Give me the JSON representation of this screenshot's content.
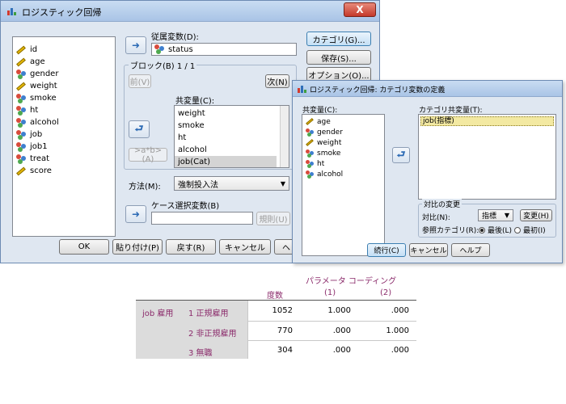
{
  "main_dialog": {
    "title": "ロジスティック回帰",
    "close_label": "X",
    "variables": [
      {
        "name": "id",
        "icon": "ruler-icon"
      },
      {
        "name": "age",
        "icon": "ruler-icon"
      },
      {
        "name": "gender",
        "icon": "nominal-icon"
      },
      {
        "name": "weight",
        "icon": "ruler-icon"
      },
      {
        "name": "smoke",
        "icon": "nominal-icon"
      },
      {
        "name": "ht",
        "icon": "nominal-icon"
      },
      {
        "name": "alcohol",
        "icon": "nominal-icon"
      },
      {
        "name": "job",
        "icon": "nominal-icon"
      },
      {
        "name": "job1",
        "icon": "nominal-icon"
      },
      {
        "name": "treat",
        "icon": "nominal-icon"
      },
      {
        "name": "score",
        "icon": "ruler-icon"
      }
    ],
    "dependent_label": "従属変数(D):",
    "dependent_value": "status",
    "block_label": "ブロック(B) 1 / 1",
    "prev_label": "前(V)",
    "next_label": "次(N)",
    "covariates_label": "共変量(C):",
    "covariates": [
      "weight",
      "smoke",
      "ht",
      "alcohol",
      "job(Cat)"
    ],
    "interaction_label": ">a*b>(A)",
    "method_label": "方法(M):",
    "method_value": "強制投入法",
    "selection_label": "ケース選択変数(B)",
    "rule_label": "規則(U)",
    "right_buttons": [
      "カテゴリ(G)...",
      "保存(S)...",
      "オプション(O)..."
    ],
    "bottom_buttons": [
      "OK",
      "貼り付け(P)",
      "戻す(R)",
      "キャンセル",
      "ヘ"
    ]
  },
  "category_dialog": {
    "title": "ロジスティック回帰: カテゴリ変数の定義",
    "covariates_label": "共変量(C):",
    "covariates": [
      {
        "name": "age",
        "icon": "ruler-icon"
      },
      {
        "name": "gender",
        "icon": "nominal-icon"
      },
      {
        "name": "weight",
        "icon": "ruler-icon"
      },
      {
        "name": "smoke",
        "icon": "nominal-icon"
      },
      {
        "name": "ht",
        "icon": "nominal-icon"
      },
      {
        "name": "alcohol",
        "icon": "nominal-icon"
      }
    ],
    "categorical_label": "カテゴリ共変量(T):",
    "categorical_item": "job(指標)",
    "contrast_group_label": "対比の変更",
    "contrast_label": "対比(N):",
    "contrast_value": "指標",
    "change_label": "変更(H)",
    "reference_label": "参照カテゴリ(R):",
    "ref_last": "最後(L)",
    "ref_first": "最初(I)",
    "continue_label": "続行(C)",
    "cancel_label": "キャンセル",
    "help_label": "ヘルプ"
  },
  "table": {
    "param_header": "パラメータ コーディング",
    "freq_header": "度数",
    "col1": "(1)",
    "col2": "(2)",
    "var_label": "job 雇用",
    "rows": [
      {
        "label": "1 正規雇用",
        "freq": "1052",
        "c1": "1.000",
        "c2": ".000"
      },
      {
        "label": "2 非正規雇用",
        "freq": "770",
        "c1": ".000",
        "c2": "1.000"
      },
      {
        "label": "3 無職",
        "freq": "304",
        "c1": ".000",
        "c2": ".000"
      }
    ]
  }
}
